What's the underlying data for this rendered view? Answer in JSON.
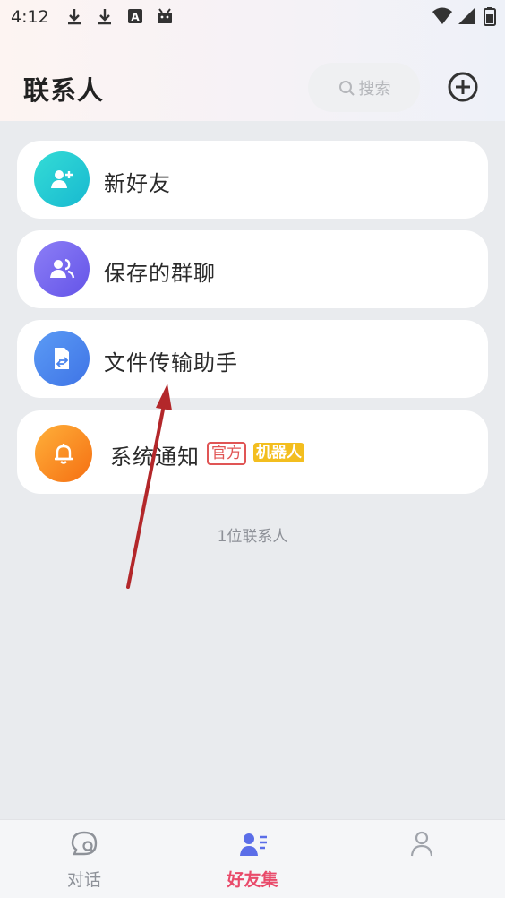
{
  "status_bar": {
    "time": "4:12",
    "left_icons": [
      "download-icon",
      "download-icon",
      "font-icon",
      "android-icon"
    ],
    "right_icons": [
      "wifi-icon",
      "cell-signal-icon",
      "battery-icon"
    ]
  },
  "header": {
    "title": "联系人",
    "search_placeholder": "搜索",
    "add_icon": "plus-circle-icon"
  },
  "items": [
    {
      "label": "新好友",
      "icon": "add-user-icon",
      "color": "#21c7d3"
    },
    {
      "label": "保存的群聊",
      "icon": "group-icon",
      "color": "#7b6cf2"
    },
    {
      "label": "文件传输助手",
      "icon": "file-transfer-icon",
      "color": "#4f8ef0"
    },
    {
      "label": "系统通知",
      "icon": "bell-icon",
      "color": "#f98a1d",
      "badges": [
        "官方",
        "机器人"
      ]
    }
  ],
  "contact_count": "1位联系人",
  "tabs": [
    {
      "label": "对话",
      "icon": "chat-icon",
      "active": false
    },
    {
      "label": "好友集",
      "icon": "contacts-icon",
      "active": true
    },
    {
      "label": "",
      "icon": "profile-icon",
      "active": false
    }
  ],
  "colors": {
    "accent": "#e94a6a",
    "badge_official": "#e05555",
    "badge_bot": "#f3be1f",
    "annotation_arrow": "#b3272a"
  }
}
